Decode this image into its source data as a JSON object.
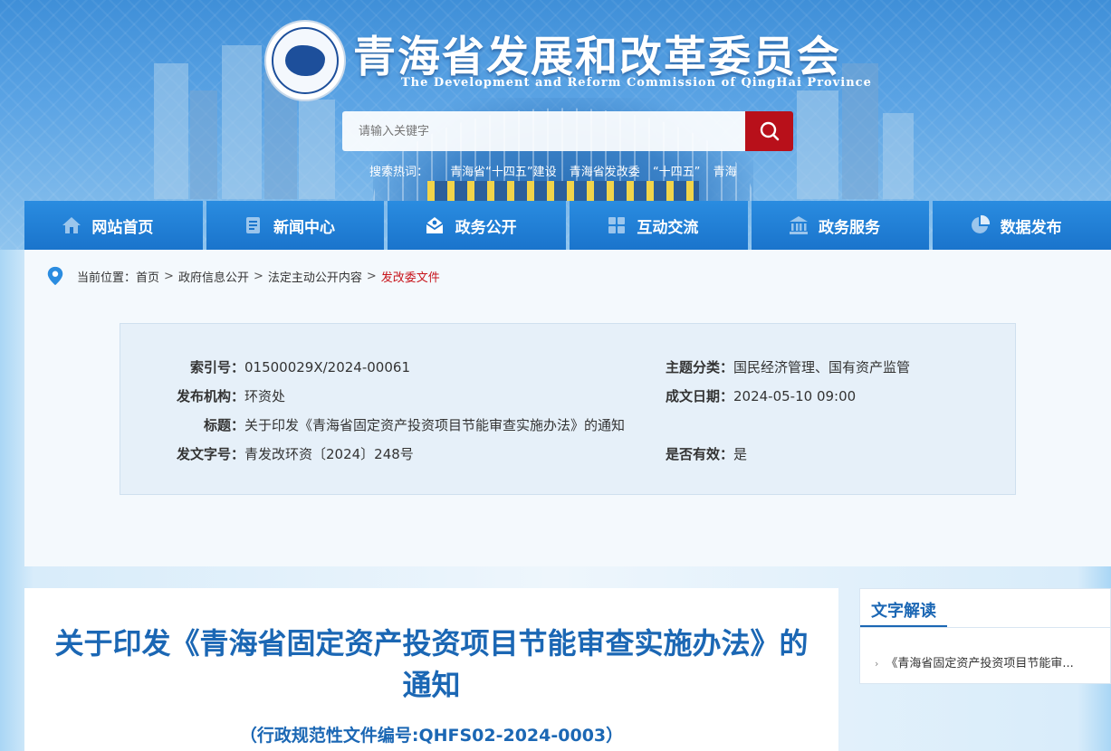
{
  "header": {
    "title": "青海省发展和改革委员会",
    "subtitle": "The Development and Reform Commission of QingHai Province",
    "search_placeholder": "请输入关键字",
    "hot_label": "搜索热词：",
    "hot_words": [
      "青海省“十四五”建设",
      "青海省发改委",
      "“十四五”",
      "青海"
    ]
  },
  "nav": [
    {
      "label": "网站首页",
      "icon": "home-icon"
    },
    {
      "label": "新闻中心",
      "icon": "news-icon"
    },
    {
      "label": "政务公开",
      "icon": "mail-icon"
    },
    {
      "label": "互动交流",
      "icon": "grid-icon"
    },
    {
      "label": "政务服务",
      "icon": "bank-icon"
    },
    {
      "label": "数据发布",
      "icon": "pie-chart-icon"
    }
  ],
  "breadcrumb": {
    "prefix": "当前位置：",
    "items": [
      "首页",
      "政府信息公开",
      "法定主动公开内容",
      "发改委文件"
    ],
    "separator": ">"
  },
  "meta": {
    "index_label": "索引号：",
    "index_value": "01500029X/2024-00061",
    "topic_label": "主题分类：",
    "topic_value": "国民经济管理、国有资产监管",
    "org_label": "发布机构：",
    "org_value": "环资处",
    "date_label": "成文日期：",
    "date_value": "2024-05-10 09:00",
    "title_label": "标题：",
    "title_value": "关于印发《青海省固定资产投资项目节能审查实施办法》的通知",
    "doc_label": "发文字号：",
    "doc_value": "青发改环资〔2024〕248号",
    "valid_label": "是否有效：",
    "valid_value": "是"
  },
  "article": {
    "title_line1": "关于印发《青海省固定资产投资项目节能审查实施办法》的",
    "title_line2": "通知",
    "code": "（行政规范性文件编号:QHFS02-2024-0003）"
  },
  "side": {
    "title": "文字解读",
    "items": [
      "《青海省固定资产投资项目节能审..."
    ]
  },
  "colors": {
    "nav": "#1a74cc",
    "accent": "#b8101a",
    "title": "#1b67b4"
  }
}
